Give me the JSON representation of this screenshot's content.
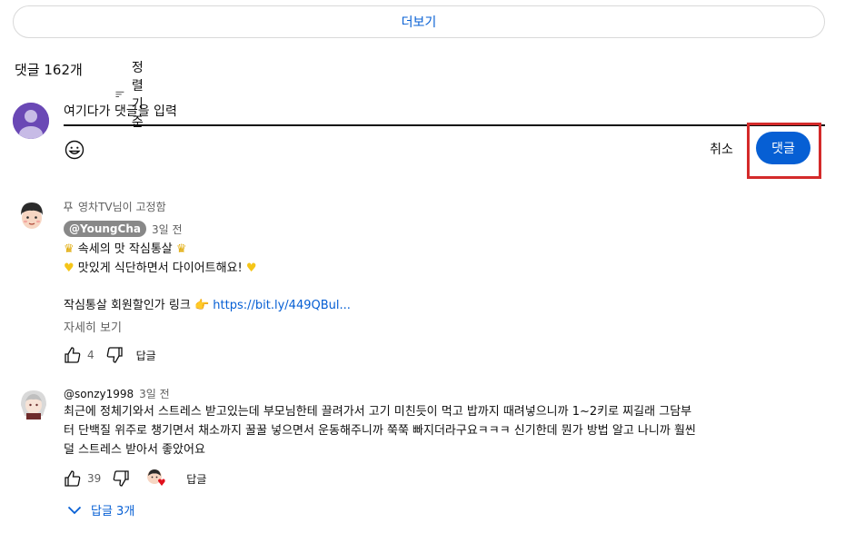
{
  "more_button": {
    "label": "더보기"
  },
  "header": {
    "count_label": "댓글 162개",
    "sort_label": "정렬 기준"
  },
  "composer": {
    "input_value": "여기다가 댓글을 입력",
    "cancel_label": "취소",
    "submit_label": "댓글"
  },
  "comments": [
    {
      "pinned_label": "영차TV님이 고정함",
      "author": "@YoungCha",
      "time": "3일 전",
      "line1": "속세의 맛 작심통살",
      "line2": "맛있게 식단하면서 다이어트해요!",
      "line3_text": "작심통살 회원할인가 링크",
      "line3_link": "https://bit.ly/449QBul...",
      "more_label": "자세히 보기",
      "likes": "4",
      "reply_label": "답글"
    },
    {
      "author": "@sonzy1998",
      "time": "3일 전",
      "line1": "최근에 정체기와서 스트레스 받고있는데 부모님한테 끌려가서 고기 미친듯이 먹고 밥까지 때려넣으니까 1~2키로 찌길래 그담부",
      "line2": "터 단백질 위주로 챙기면서 채소까지 꿀꿀 넣으면서 운동해주니까 쭉쭉 빠지더라구요ㅋㅋㅋ 신기한데 뭔가 방법 알고 나니까 훨씬",
      "line3": "덜 스트레스 받아서 좋았어요",
      "likes": "39",
      "reply_label": "답글",
      "replies_label": "답글 3개"
    }
  ],
  "colors": {
    "accent": "#065fd4",
    "highlight": "#d42a2a",
    "my_avatar": "#6a48b5"
  }
}
